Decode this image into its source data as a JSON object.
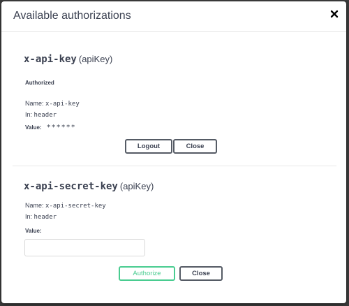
{
  "dialog": {
    "title": "Available authorizations",
    "close_icon": "close-icon"
  },
  "schemes": [
    {
      "name": "x-api-key",
      "type": "(apiKey)",
      "status": "Authorized",
      "name_label": "Name:",
      "name_value": "x-api-key",
      "in_label": "In:",
      "in_value": "header",
      "value_label": "Value:",
      "value": "******",
      "buttons": {
        "primary": "Logout",
        "secondary": "Close"
      }
    },
    {
      "name": "x-api-secret-key",
      "type": "(apiKey)",
      "name_label": "Name:",
      "name_value": "x-api-secret-key",
      "in_label": "In:",
      "in_value": "header",
      "value_label": "Value:",
      "value_input": "",
      "buttons": {
        "primary": "Authorize",
        "secondary": "Close"
      }
    }
  ],
  "colors": {
    "text": "#3b4151",
    "authorize_accent": "#49cc90",
    "button_border": "#555b65",
    "backdrop": "#3b3b3b"
  }
}
